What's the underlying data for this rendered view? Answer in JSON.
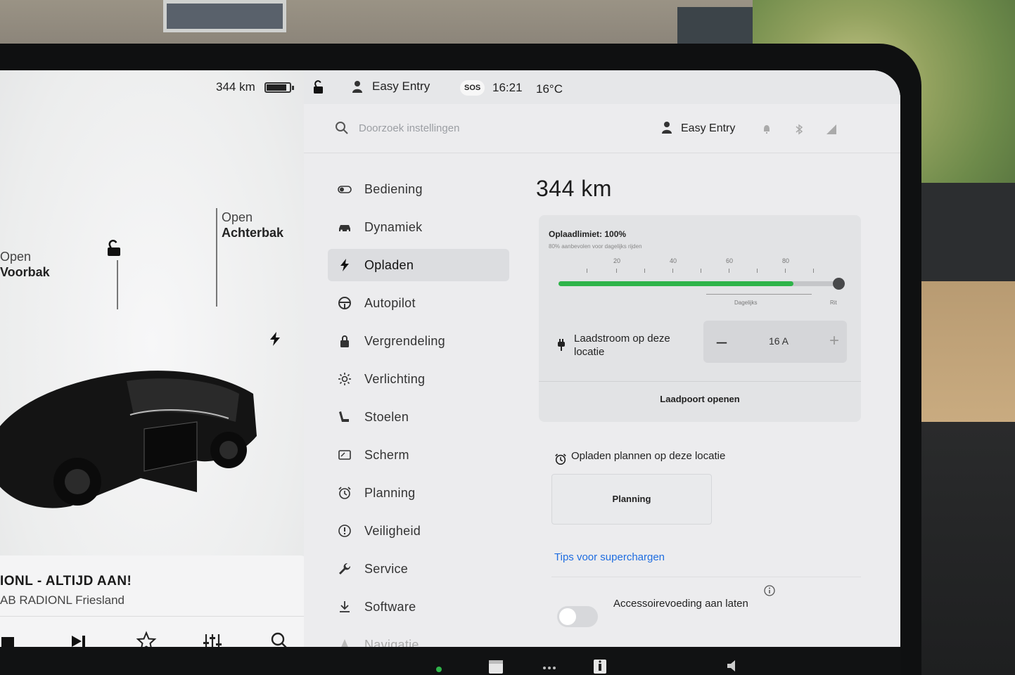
{
  "status_bar": {
    "range": "344 km",
    "profile": "Easy Entry",
    "sos": "SOS",
    "time": "16:21",
    "temperature": "16°C"
  },
  "vehicle": {
    "frunk_action": "Open",
    "frunk_name": "Voorbak",
    "trunk_action": "Open",
    "trunk_name": "Achterbak"
  },
  "media": {
    "title": "IONL - ALTIJD AAN!",
    "subtitle": "AB RADIONL Friesland"
  },
  "search": {
    "placeholder": "Doorzoek instellingen"
  },
  "header": {
    "profile": "Easy Entry"
  },
  "nav": {
    "items": [
      {
        "label": "Bediening",
        "icon": "toggle-icon"
      },
      {
        "label": "Dynamiek",
        "icon": "car-icon"
      },
      {
        "label": "Opladen",
        "icon": "bolt-icon",
        "active": true
      },
      {
        "label": "Autopilot",
        "icon": "steering-wheel-icon"
      },
      {
        "label": "Vergrendeling",
        "icon": "lock-icon"
      },
      {
        "label": "Verlichting",
        "icon": "sun-icon"
      },
      {
        "label": "Stoelen",
        "icon": "seat-icon"
      },
      {
        "label": "Scherm",
        "icon": "display-icon"
      },
      {
        "label": "Planning",
        "icon": "alarm-clock-icon"
      },
      {
        "label": "Veiligheid",
        "icon": "alert-icon"
      },
      {
        "label": "Service",
        "icon": "wrench-icon"
      },
      {
        "label": "Software",
        "icon": "download-icon"
      },
      {
        "label": "Navigatie",
        "icon": "navigation-icon"
      }
    ]
  },
  "charging": {
    "range_title": "344 km",
    "limit_label": "Oplaadlimiet: 100%",
    "limit_hint": "80% aanbevolen voor dagelijks rijden",
    "limit_percent": 100,
    "fill_percent": 84,
    "scale_labels": [
      "20",
      "40",
      "60",
      "80"
    ],
    "zone_daily": "Dagelijks",
    "zone_trip": "Rit",
    "current_label": "Laadstroom op deze locatie",
    "current_value": "16 A",
    "minus_label": "–",
    "plus_label": "+",
    "port_button": "Laadpoort openen"
  },
  "schedule": {
    "title": "Opladen plannen op deze locatie",
    "button": "Planning"
  },
  "tips_link": "Tips voor superchargen",
  "accessory": {
    "label": "Accessoirevoeding aan laten",
    "enabled": false
  },
  "colors": {
    "accent_green": "#2fb44a",
    "link_blue": "#1f6de0",
    "screen_bg": "#eeeff1"
  }
}
